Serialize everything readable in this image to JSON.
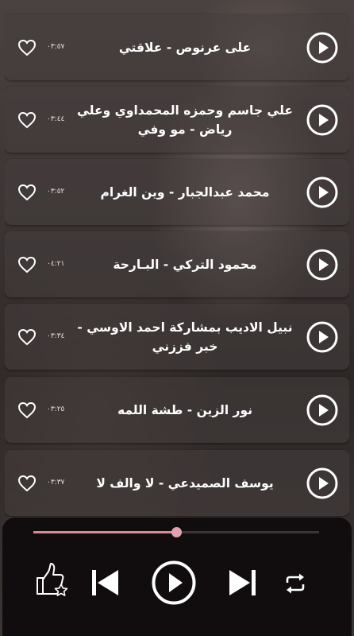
{
  "playlist": [
    {
      "title": "على عرنوص - علاقتي",
      "duration": "٠٣:٥٧"
    },
    {
      "title": "علي جاسم وحمزه المحمداوي وعلي رياض - مو وفي",
      "duration": "٠٣:٤٤"
    },
    {
      "title": "محمد عبدالجبار - وين الغرام",
      "duration": "٠٣:٥٢"
    },
    {
      "title": "محمود التركي - البـارحة",
      "duration": "٠٤:٢١"
    },
    {
      "title": "نبيل الاديب بمشاركة احمد الاوسي - خبر فززني",
      "duration": "٠٣:٣٤"
    },
    {
      "title": "نور الزين - طشة اللمه",
      "duration": "٠٣:٢٥"
    },
    {
      "title": "يوسف الصميدعي - لا والف لا",
      "duration": "٠٣:٣٧"
    }
  ],
  "player": {
    "progress": 0.5
  },
  "icons": {
    "favorite": "heart-outline-icon",
    "play_item": "play-circle-icon",
    "rate": "thumbs-up-star-icon",
    "previous": "skip-previous-icon",
    "play": "play-circle-icon",
    "next": "skip-next-icon",
    "repeat": "repeat-icon"
  },
  "colors": {
    "accent": "#e4a0b0",
    "player_bg": "#110d0e",
    "text": "#ffffff"
  }
}
